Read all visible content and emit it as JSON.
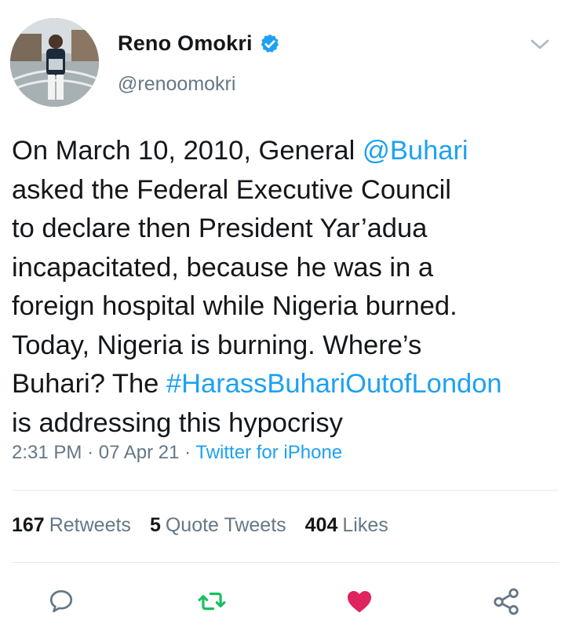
{
  "author": {
    "name": "Reno Omokri",
    "handle": "@renoomokri",
    "verified": true
  },
  "tweet": {
    "segments": [
      {
        "text": "On March 10, 2010, General ",
        "link": false
      },
      {
        "text": "@Buhari",
        "link": true
      },
      {
        "text": "\nasked the Federal Executive Council\nto declare then President Yar’adua\nincapacitated, because he was in a\nforeign hospital while Nigeria burned.\nToday, Nigeria is burning. Where’s\nBuhari? The ",
        "link": false
      },
      {
        "text": "#HarassBuhariOutofLondon",
        "link": true
      },
      {
        "text": "\nis addressing this hypocrisy",
        "link": false
      }
    ]
  },
  "meta": {
    "time": "2:31 PM",
    "sep1": "·",
    "date": "07 Apr 21",
    "sep2": "·",
    "source": "Twitter for iPhone"
  },
  "stats": {
    "retweets_count": "167",
    "retweets_label": "Retweets",
    "quotes_count": "5",
    "quotes_label": "Quote Tweets",
    "likes_count": "404",
    "likes_label": "Likes"
  },
  "icons": {
    "reply": "speech-bubble-icon",
    "retweet": "retweet-icon",
    "like": "heart-icon",
    "share": "share-icon",
    "menu": "chevron-down-icon",
    "verified": "verified-badge-icon"
  },
  "colors": {
    "link": "#1da1f2",
    "secondary_text": "#657786",
    "retweet_active": "#17bf63",
    "like_active": "#e0245e"
  }
}
